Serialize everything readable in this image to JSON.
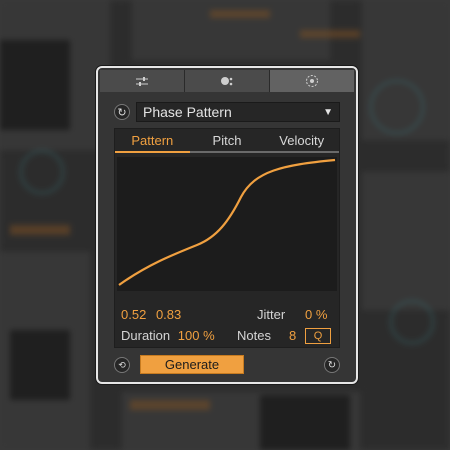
{
  "colors": {
    "accent": "#f0a040",
    "panel": "#262626",
    "frame": "#e6e6e6"
  },
  "toolbar": {
    "buttons": [
      {
        "icon": "sliders-icon"
      },
      {
        "icon": "dots-icon"
      },
      {
        "icon": "target-icon"
      }
    ]
  },
  "preset": {
    "reset_icon": "reset-icon",
    "value": "Phase Pattern",
    "arrow": "▼"
  },
  "tabs": [
    {
      "label": "Pattern",
      "active": true
    },
    {
      "label": "Pitch",
      "active": false
    },
    {
      "label": "Velocity",
      "active": false
    }
  ],
  "curve": {
    "description_type": "s-curve"
  },
  "params": {
    "value_a": "0.52",
    "value_b": "0.83",
    "jitter_label": "Jitter",
    "jitter_value": "0 %",
    "duration_label": "Duration",
    "duration_value": "100 %",
    "notes_label": "Notes",
    "notes_value": "8",
    "q_label": "Q"
  },
  "footer": {
    "generate_label": "Generate",
    "loop_icon": "loop-icon",
    "refresh_icon": "refresh-icon"
  }
}
